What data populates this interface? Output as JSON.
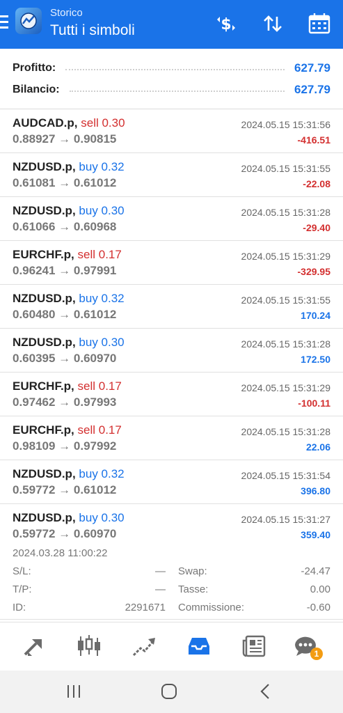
{
  "header": {
    "subtitle": "Storico",
    "title": "Tutti i simboli"
  },
  "summary": {
    "profit_label": "Profitto:",
    "profit_value": "627.79",
    "balance_label": "Bilancio:",
    "balance_value": "627.79"
  },
  "trades": [
    {
      "symbol": "AUDCAD.p,",
      "side": "sell 0.30",
      "prices": "0.88927 → 0.90815",
      "time": "2024.05.15 15:31:56",
      "pnl": "-416.51"
    },
    {
      "symbol": "NZDUSD.p,",
      "side": "buy 0.32",
      "prices": "0.61081 → 0.61012",
      "time": "2024.05.15 15:31:55",
      "pnl": "-22.08"
    },
    {
      "symbol": "NZDUSD.p,",
      "side": "buy 0.30",
      "prices": "0.61066 → 0.60968",
      "time": "2024.05.15 15:31:28",
      "pnl": "-29.40"
    },
    {
      "symbol": "EURCHF.p,",
      "side": "sell 0.17",
      "prices": "0.96241 → 0.97991",
      "time": "2024.05.15 15:31:29",
      "pnl": "-329.95"
    },
    {
      "symbol": "NZDUSD.p,",
      "side": "buy 0.32",
      "prices": "0.60480 → 0.61012",
      "time": "2024.05.15 15:31:55",
      "pnl": "170.24"
    },
    {
      "symbol": "NZDUSD.p,",
      "side": "buy 0.30",
      "prices": "0.60395 → 0.60970",
      "time": "2024.05.15 15:31:28",
      "pnl": "172.50"
    },
    {
      "symbol": "EURCHF.p,",
      "side": "sell 0.17",
      "prices": "0.97462 → 0.97993",
      "time": "2024.05.15 15:31:29",
      "pnl": "-100.11"
    },
    {
      "symbol": "EURCHF.p,",
      "side": "sell 0.17",
      "prices": "0.98109 → 0.97992",
      "time": "2024.05.15 15:31:28",
      "pnl": "22.06"
    },
    {
      "symbol": "NZDUSD.p,",
      "side": "buy 0.32",
      "prices": "0.59772 → 0.61012",
      "time": "2024.05.15 15:31:54",
      "pnl": "396.80"
    },
    {
      "symbol": "NZDUSD.p,",
      "side": "buy 0.30",
      "prices": "0.59772 → 0.60970",
      "time": "2024.05.15 15:31:27",
      "pnl": "359.40"
    }
  ],
  "expanded_detail": {
    "open_time": "2024.03.28 11:00:22",
    "sl_label": "S/L:",
    "sl_value": "—",
    "tp_label": "T/P:",
    "tp_value": "—",
    "id_label": "ID:",
    "id_value": "2291671",
    "swap_label": "Swap:",
    "swap_value": "-24.47",
    "tax_label": "Tasse:",
    "tax_value": "0.00",
    "commission_label": "Commissione:",
    "commission_value": "-0.60"
  },
  "bottom_nav": {
    "items": [
      "quotes-icon",
      "chart-icon",
      "trade-icon",
      "history-icon",
      "news-icon",
      "messages-icon"
    ],
    "active": "history-icon",
    "messages_badge": "1"
  },
  "colors": {
    "accent": "#1a73e8",
    "loss": "#d32f2f",
    "badge": "#f39c12"
  }
}
